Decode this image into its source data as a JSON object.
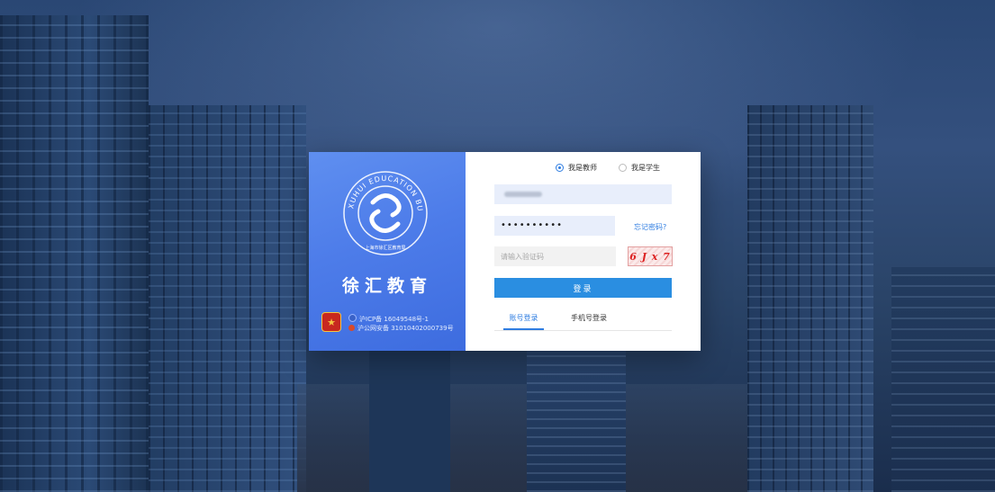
{
  "branding": {
    "title": "徐汇教育",
    "logo_text_outer": "XUHUI EDUCATION BUREAU SHANGHAI",
    "logo_text_inner": "上海市徐汇区教育局",
    "badge_icon": "police-badge-icon"
  },
  "footer": {
    "icp": "沪ICP备 16049548号-1",
    "police": "沪公网安备 31010402000739号"
  },
  "role": {
    "options": [
      "我是教师",
      "我是学生"
    ],
    "selected": "我是教师"
  },
  "form": {
    "password_mask": "••••••••••",
    "captcha_placeholder": "请输入验证码",
    "captcha_text": "6 J x 7",
    "forgot_label": "忘记密码?",
    "login_label": "登录"
  },
  "tabs": {
    "account": "账号登录",
    "phone": "手机号登录",
    "active": "账号登录"
  },
  "colors": {
    "accent": "#2a8ee1",
    "panel_gradient_start": "#5f8ff0",
    "panel_gradient_end": "#3d6cdf",
    "captcha_red": "#d22222"
  }
}
